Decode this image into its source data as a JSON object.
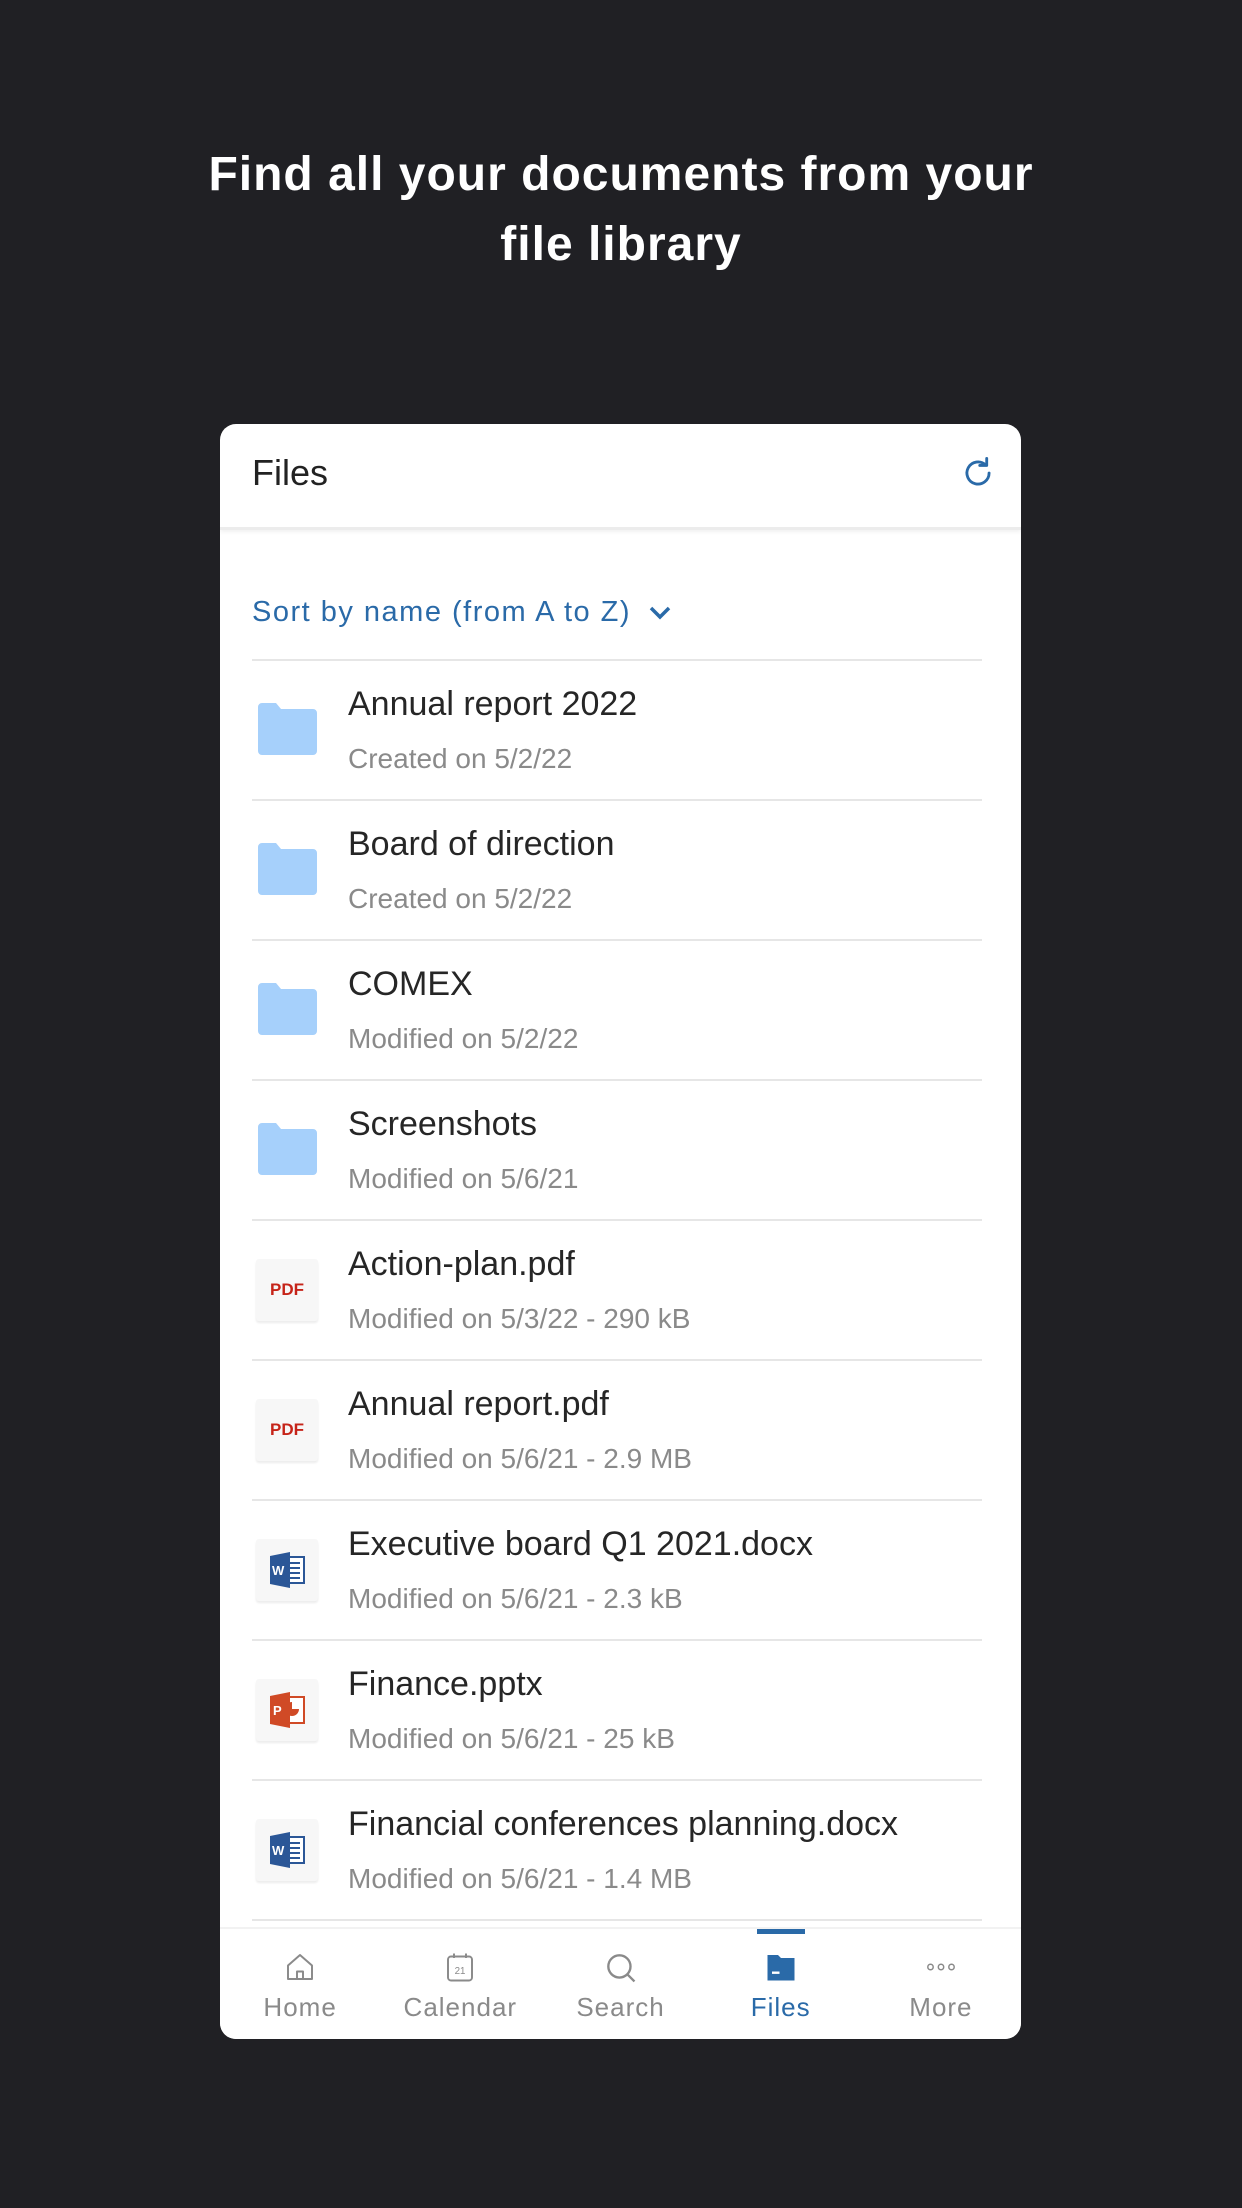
{
  "headline": {
    "line1": "Find all your documents from your",
    "line2": "file library"
  },
  "header": {
    "title": "Files",
    "refresh_icon": "refresh-icon"
  },
  "sort": {
    "label": "Sort by name (from A to Z)"
  },
  "colors": {
    "accent": "#2a6aa8",
    "folder": "#a6d0fb",
    "pdf": "#c62419",
    "word": "#2b5797",
    "powerpoint": "#d04a26"
  },
  "files": [
    {
      "type": "folder",
      "name": "Annual report 2022",
      "meta": "Created on 5/2/22"
    },
    {
      "type": "folder",
      "name": "Board of direction",
      "meta": "Created on 5/2/22"
    },
    {
      "type": "folder",
      "name": "COMEX",
      "meta": "Modified on 5/2/22"
    },
    {
      "type": "folder",
      "name": "Screenshots",
      "meta": "Modified on 5/6/21"
    },
    {
      "type": "pdf",
      "name": "Action-plan.pdf",
      "meta": "Modified on 5/3/22 - 290 kB",
      "badge": "PDF"
    },
    {
      "type": "pdf",
      "name": "Annual report.pdf",
      "meta": "Modified on 5/6/21 - 2.9 MB",
      "badge": "PDF"
    },
    {
      "type": "word",
      "name": "Executive board Q1 2021.docx",
      "meta": "Modified on 5/6/21 - 2.3 kB"
    },
    {
      "type": "powerpoint",
      "name": "Finance.pptx",
      "meta": "Modified on 5/6/21 - 25 kB"
    },
    {
      "type": "word",
      "name": "Financial conferences planning.docx",
      "meta": "Modified on 5/6/21 - 1.4 MB"
    }
  ],
  "nav": [
    {
      "label": "Home",
      "icon": "home-icon"
    },
    {
      "label": "Calendar",
      "icon": "calendar-icon",
      "day": "21"
    },
    {
      "label": "Search",
      "icon": "search-icon"
    },
    {
      "label": "Files",
      "icon": "folder-icon",
      "active": true
    },
    {
      "label": "More",
      "icon": "more-icon"
    }
  ]
}
